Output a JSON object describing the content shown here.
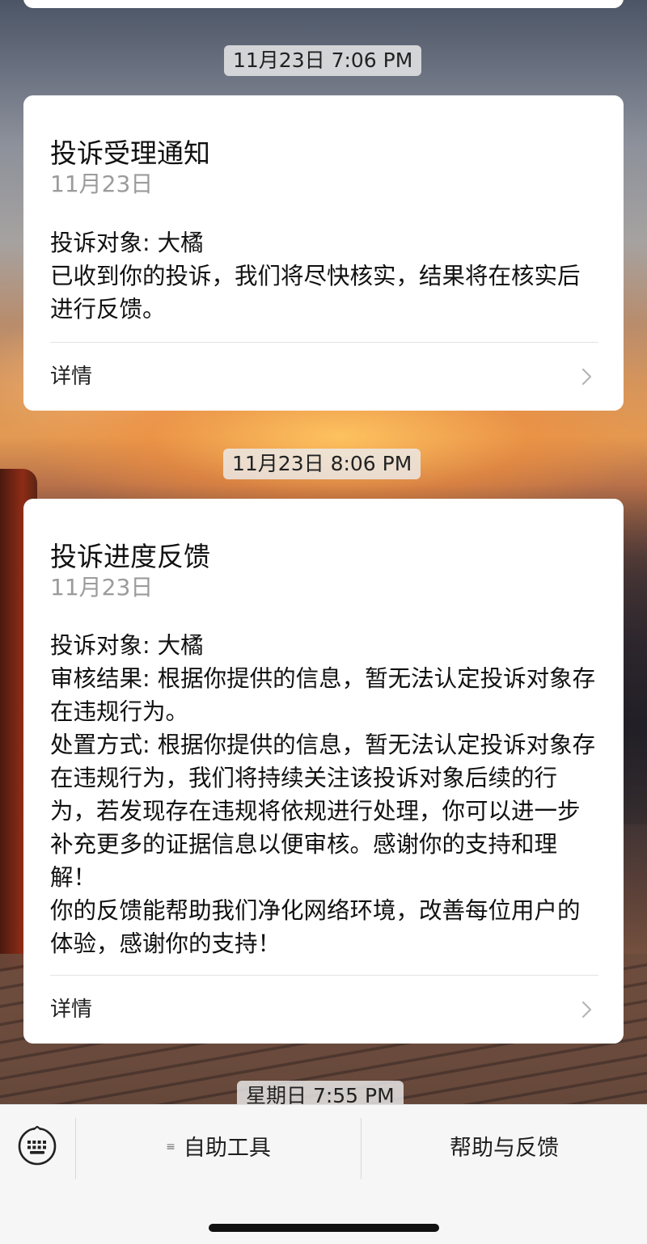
{
  "timestamps": {
    "first": "11月23日 7:06 PM",
    "second": "11月23日 8:06 PM",
    "third": "星期日 7:55 PM"
  },
  "messages": [
    {
      "title": "投诉受理通知",
      "date": "11月23日",
      "lines": [
        "投诉对象: 大橘",
        "已收到你的投诉，我们将尽快核实，结果将在核实后进行反馈。"
      ],
      "detail_label": "详情"
    },
    {
      "title": "投诉进度反馈",
      "date": "11月23日",
      "lines": [
        "投诉对象: 大橘",
        "审核结果: 根据你提供的信息，暂无法认定投诉对象存在违规行为。",
        "处置方式: 根据你提供的信息，暂无法认定投诉对象存在违规行为，我们将持续关注该投诉对象后续的行为，若发现存在违规将依规进行处理，你可以进一步补充更多的证据信息以便审核。感谢你的支持和理解！",
        "你的反馈能帮助我们净化网络环境，改善每位用户的体验，感谢你的支持！"
      ],
      "detail_label": "详情"
    }
  ],
  "bottom_bar": {
    "keyboard_icon": "keyboard-icon",
    "menu_icon": "menu-lines-icon",
    "menu_left_label": "自助工具",
    "menu_right_label": "帮助与反馈"
  }
}
